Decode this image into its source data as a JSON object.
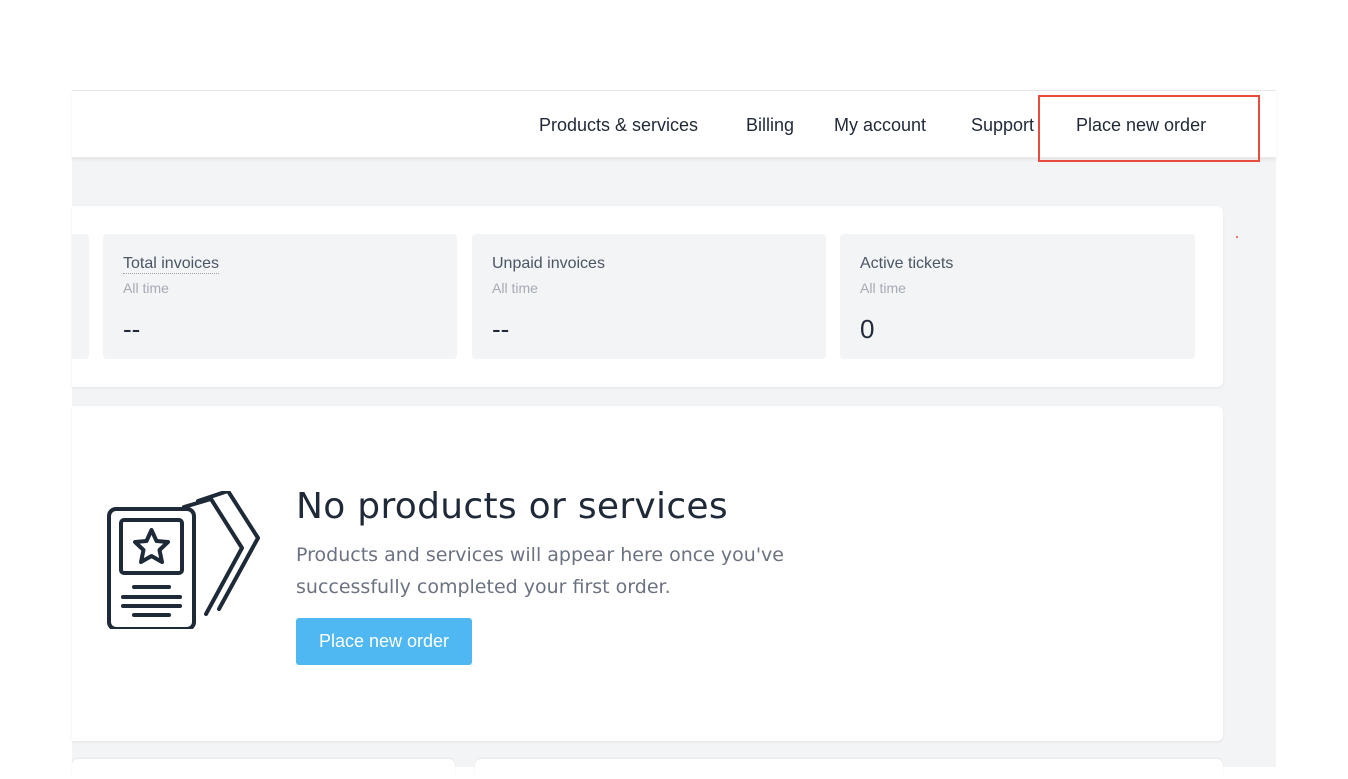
{
  "nav": {
    "items": [
      "Products & services",
      "Billing",
      "My account",
      "Support",
      "Place new order"
    ]
  },
  "stats": [
    {
      "title": "Total invoices",
      "subtitle": "All time",
      "value": "--"
    },
    {
      "title": "Unpaid invoices",
      "subtitle": "All time",
      "value": "--"
    },
    {
      "title": "Active tickets",
      "subtitle": "All time",
      "value": "0"
    }
  ],
  "empty_state": {
    "icon": "document-star-cards-icon",
    "title": "No products or services",
    "description": "Products and services will appear here once you've successfully completed your first order.",
    "button_label": "Place new order"
  },
  "colors": {
    "accent_button": "#4fb7f2",
    "highlight": "#e74c3c",
    "page_background": "#f3f4f6"
  }
}
